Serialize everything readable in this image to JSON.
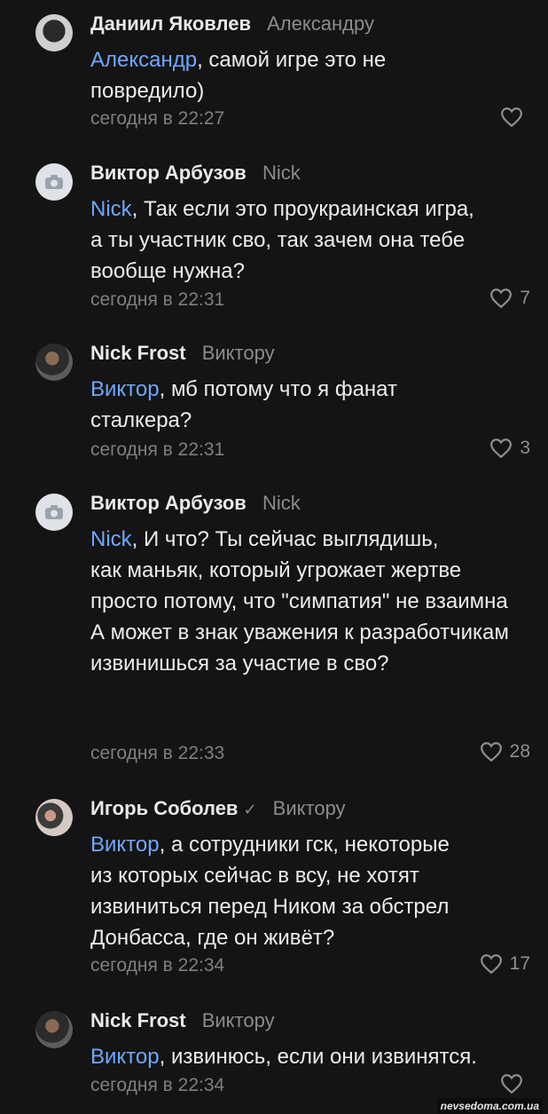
{
  "comments": [
    {
      "author": "Даниил Яковлев",
      "reply_to": "Александру",
      "mention": "Александр",
      "text_line1": ", самой игре это не",
      "text_rest": "повредило)",
      "time": "сегодня в 22:27",
      "likes": ""
    },
    {
      "author": "Виктор Арбузов",
      "reply_to": "Nick",
      "mention": "Nick",
      "text_line1": ", Так если это проукраинская игра,",
      "text_rest": "а ты участник сво, так зачем она тебе вообще нужна?",
      "time": "сегодня в 22:31",
      "likes": "7"
    },
    {
      "author": "Nick Frost",
      "reply_to": "Виктору",
      "mention": "Виктор",
      "text_line1": ", мб потому что я фанат",
      "text_rest": "сталкера?",
      "time": "сегодня в 22:31",
      "likes": "3"
    },
    {
      "author": "Виктор Арбузов",
      "reply_to": "Nick",
      "mention": "Nick",
      "text_line1": ", И что? Ты сейчас выглядишь,",
      "text_rest": "как маньяк, который угрожает жертве просто потому, что \"симпатия\" не взаимна",
      "text_para2": "А может в знак уважения к разработчикам извинишься за участие в сво?",
      "time": "сегодня в 22:33",
      "likes": "28"
    },
    {
      "author": "Игорь Соболев",
      "verified": "✓",
      "reply_to": "Виктору",
      "mention": "Виктор",
      "text_line1": ", а сотрудники гск, некоторые",
      "text_rest": "из которых сейчас в всу, не хотят извиниться перед Ником за обстрел Донбасса, где он живёт?",
      "time": "сегодня в 22:34",
      "likes": "17"
    },
    {
      "author": "Nick Frost",
      "reply_to": "Виктору",
      "mention": "Виктор",
      "text_line1": ", извинюсь, если они извинятся.",
      "text_rest": "",
      "time": "сегодня в 22:34",
      "likes": ""
    }
  ],
  "watermark": "nevsedoma.com.ua",
  "colors": {
    "background": "#141414",
    "mention": "#6fa8ff",
    "muted": "#7f7f7f"
  },
  "icons": {
    "like": "heart-outline-icon",
    "camera": "camera-icon",
    "verified": "checkmark-icon"
  }
}
